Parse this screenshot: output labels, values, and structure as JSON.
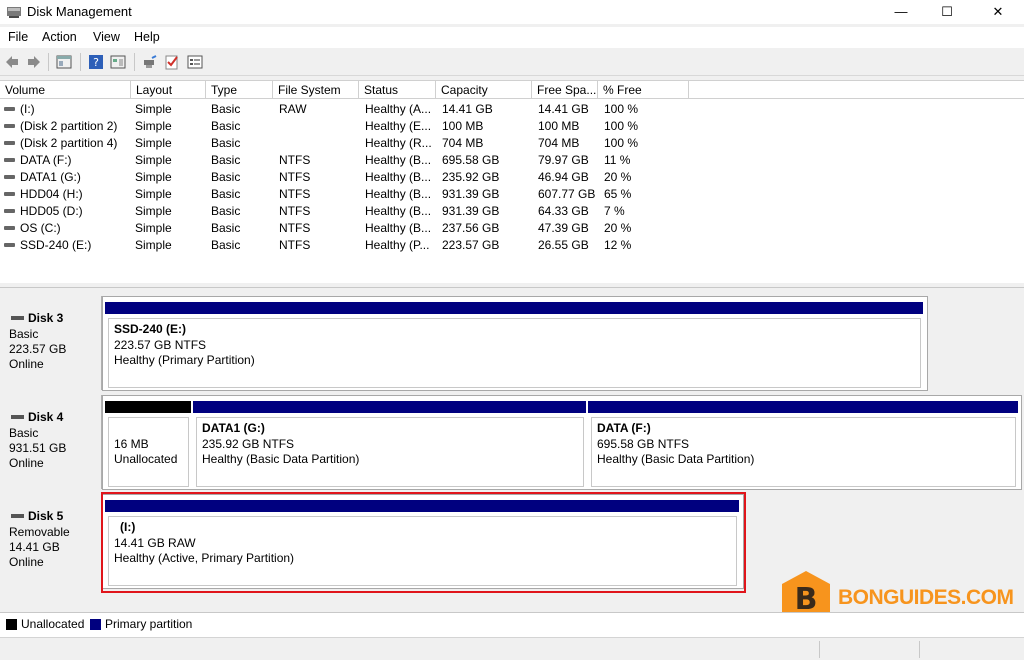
{
  "window": {
    "title": "Disk Management",
    "minimize": "—",
    "maximize": "☐",
    "close": "✕"
  },
  "menu": [
    "File",
    "Action",
    "View",
    "Help"
  ],
  "columns": [
    "Volume",
    "Layout",
    "Type",
    "File System",
    "Status",
    "Capacity",
    "Free Spa...",
    "% Free"
  ],
  "volumes": [
    {
      "volume": "(I:)",
      "layout": "Simple",
      "type": "Basic",
      "fs": "RAW",
      "status": "Healthy (A...",
      "capacity": "14.41 GB",
      "free": "14.41 GB",
      "pct": "100 %"
    },
    {
      "volume": "(Disk 2 partition 2)",
      "layout": "Simple",
      "type": "Basic",
      "fs": "",
      "status": "Healthy (E...",
      "capacity": "100 MB",
      "free": "100 MB",
      "pct": "100 %"
    },
    {
      "volume": "(Disk 2 partition 4)",
      "layout": "Simple",
      "type": "Basic",
      "fs": "",
      "status": "Healthy (R...",
      "capacity": "704 MB",
      "free": "704 MB",
      "pct": "100 %"
    },
    {
      "volume": "DATA (F:)",
      "layout": "Simple",
      "type": "Basic",
      "fs": "NTFS",
      "status": "Healthy (B...",
      "capacity": "695.58 GB",
      "free": "79.97 GB",
      "pct": "11 %"
    },
    {
      "volume": "DATA1 (G:)",
      "layout": "Simple",
      "type": "Basic",
      "fs": "NTFS",
      "status": "Healthy (B...",
      "capacity": "235.92 GB",
      "free": "46.94 GB",
      "pct": "20 %"
    },
    {
      "volume": "HDD04 (H:)",
      "layout": "Simple",
      "type": "Basic",
      "fs": "NTFS",
      "status": "Healthy (B...",
      "capacity": "931.39 GB",
      "free": "607.77 GB",
      "pct": "65 %"
    },
    {
      "volume": "HDD05 (D:)",
      "layout": "Simple",
      "type": "Basic",
      "fs": "NTFS",
      "status": "Healthy (B...",
      "capacity": "931.39 GB",
      "free": "64.33 GB",
      "pct": "7 %"
    },
    {
      "volume": "OS (C:)",
      "layout": "Simple",
      "type": "Basic",
      "fs": "NTFS",
      "status": "Healthy (B...",
      "capacity": "237.56 GB",
      "free": "47.39 GB",
      "pct": "20 %"
    },
    {
      "volume": "SSD-240 (E:)",
      "layout": "Simple",
      "type": "Basic",
      "fs": "NTFS",
      "status": "Healthy (P...",
      "capacity": "223.57 GB",
      "free": "26.55 GB",
      "pct": "12 %"
    }
  ],
  "disks": [
    {
      "name": "Disk 3",
      "kind": "Basic",
      "size": "223.57 GB",
      "state": "Online",
      "partitions": [
        {
          "name": "SSD-240  (E:)",
          "size": "223.57 GB NTFS",
          "status": "Healthy (Primary Partition)"
        }
      ]
    },
    {
      "name": "Disk 4",
      "kind": "Basic",
      "size": "931.51 GB",
      "state": "Online",
      "partitions": [
        {
          "name": "",
          "size": "16 MB",
          "status": "Unallocated"
        },
        {
          "name": "DATA1  (G:)",
          "size": "235.92 GB NTFS",
          "status": "Healthy (Basic Data Partition)"
        },
        {
          "name": "DATA  (F:)",
          "size": "695.58 GB NTFS",
          "status": "Healthy (Basic Data Partition)"
        }
      ]
    },
    {
      "name": "Disk 5",
      "kind": "Removable",
      "size": "14.41 GB",
      "state": "Online",
      "partitions": [
        {
          "name": "(I:)",
          "size": "14.41 GB RAW",
          "status": "Healthy (Active, Primary Partition)"
        }
      ]
    }
  ],
  "legend": {
    "unallocated": "Unallocated",
    "primary": "Primary partition"
  },
  "watermark": {
    "text": "BONGUIDES.COM",
    "letter": "B"
  },
  "colors": {
    "primary": "#00007f",
    "unallocated": "#000000",
    "highlight": "#e0151b",
    "watermark": "#f7941d"
  }
}
